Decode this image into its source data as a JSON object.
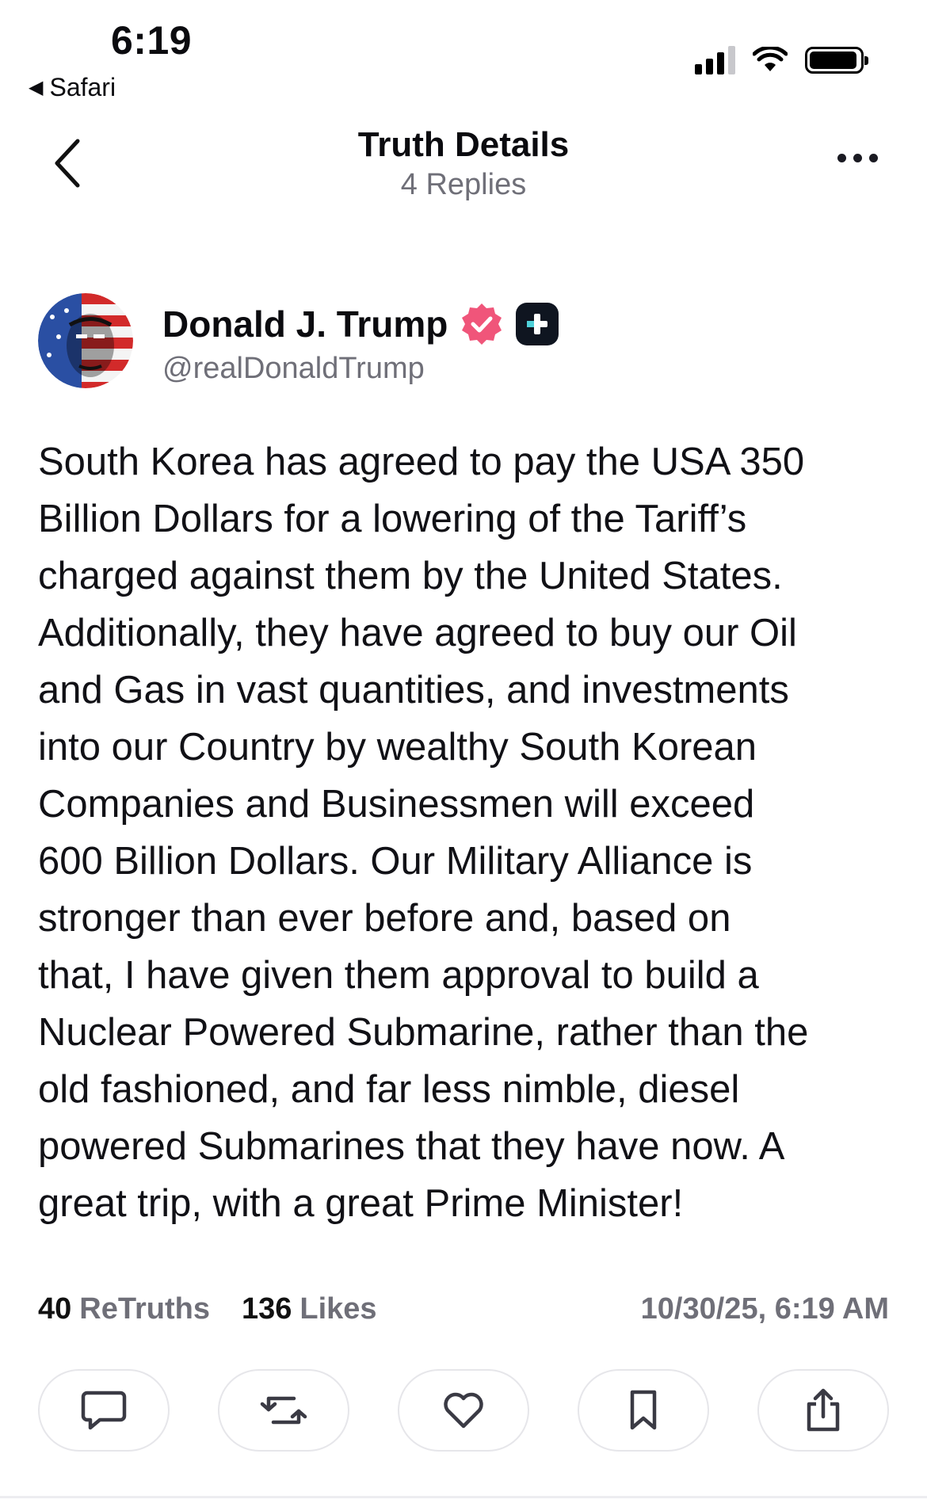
{
  "status_bar": {
    "time": "6:19",
    "back_app": "Safari"
  },
  "nav": {
    "title": "Truth Details",
    "subtitle": "4 Replies"
  },
  "author": {
    "name": "Donald J. Trump",
    "handle": "@realDonaldTrump"
  },
  "post": {
    "text": "South Korea has agreed to pay the USA 350\nBillion Dollars for a lowering of the Tariff’s\ncharged against them by the United States.\nAdditionally, they have agreed to buy our Oil\nand Gas in vast quantities, and investments\ninto our Country by wealthy South Korean\nCompanies and Businessmen will exceed\n600 Billion Dollars. Our Military Alliance is\nstronger than ever before and, based on\nthat, I have given them approval to build a\nNuclear Powered Submarine, rather than the\nold fashioned, and far less nimble, diesel\npowered Submarines that they have now. A\ngreat trip, with a great Prime Minister!"
  },
  "stats": {
    "retruths_count": "40",
    "retruths_label": "ReTruths",
    "likes_count": "136",
    "likes_label": "Likes",
    "timestamp": "10/30/25, 6:19 AM"
  },
  "icons": {
    "back": "chevron-left-icon",
    "more": "more-horizontal-icon",
    "verified": "verified-badge-icon",
    "plus": "truth-plus-badge-icon",
    "actions": [
      "reply-icon",
      "retruth-icon",
      "like-icon",
      "bookmark-icon",
      "share-icon"
    ]
  },
  "colors": {
    "verified_badge": "#f0557a",
    "muted_text": "#6f6f78",
    "plus_badge": "#0f1520"
  }
}
